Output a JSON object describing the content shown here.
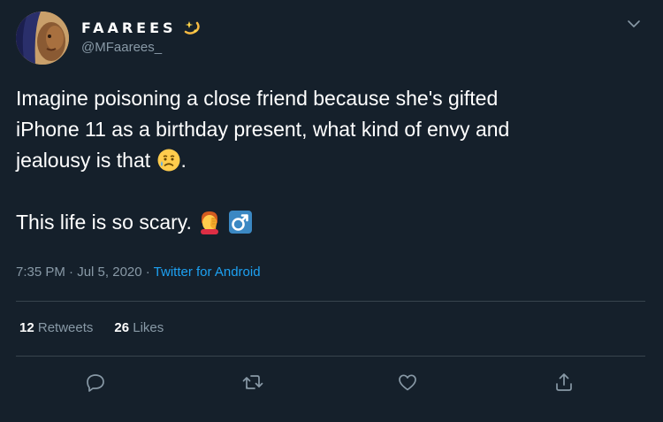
{
  "author": {
    "display_name": "FAAREES",
    "name_emoji": "sparkle-emoji",
    "handle": "@MFaarees_"
  },
  "tweet": {
    "line1": "Imagine poisoning a close friend because she's gifted",
    "line2": "iPhone 11 as a birthday present, what kind of envy and",
    "line3_before": "jealousy is that ",
    "line3_after": ".",
    "line4": "This life is so scary. ",
    "emojis": [
      "sad-relieved-face-emoji",
      "facepalm-emoji",
      "male-sign-emoji"
    ]
  },
  "meta": {
    "time": "7:35 PM",
    "sep1": " · ",
    "date": "Jul 5, 2020",
    "sep2": " · ",
    "source": "Twitter for Android"
  },
  "stats": {
    "retweets_count": "12",
    "retweets_label": "Retweets",
    "likes_count": "26",
    "likes_label": "Likes"
  },
  "colors": {
    "background": "#15202b",
    "secondary_text": "#8899a6",
    "accent": "#1da1f2",
    "divider": "#38444d"
  },
  "icons": [
    "chevron-down-icon",
    "reply-icon",
    "retweet-icon",
    "like-icon",
    "share-icon"
  ]
}
